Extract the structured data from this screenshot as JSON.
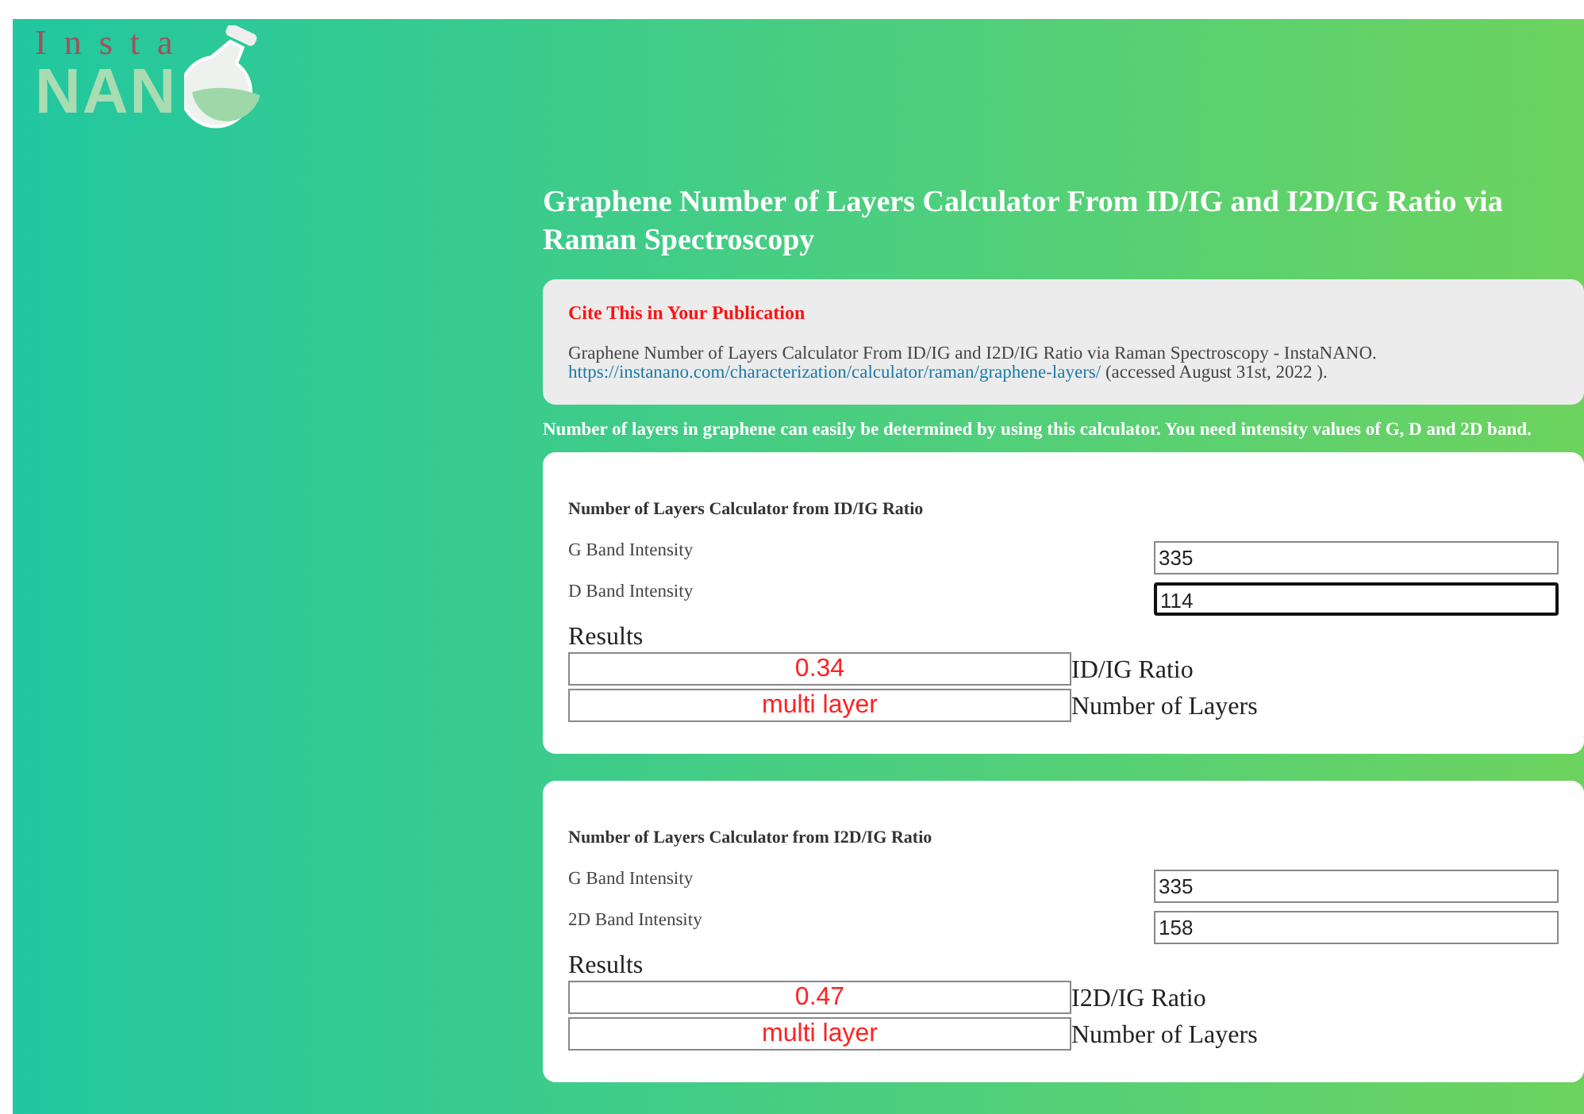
{
  "logo": {
    "top": "Insta",
    "bottom": "NAN"
  },
  "title": "Graphene Number of Layers Calculator From ID/IG and I2D/IG Ratio via Raman Spectroscopy",
  "citation": {
    "heading": "Cite This in Your Publication",
    "text": "Graphene Number of Layers Calculator From ID/IG and I2D/IG Ratio via Raman Spectroscopy - InstaNANO.",
    "link": "https://instanano.com/characterization/calculator/raman/graphene-layers/",
    "accessed": "(accessed August 31st, 2022 )."
  },
  "intro": "Number of layers in graphene can easily be determined by using this calculator. You need intensity values of G, D and 2D band.",
  "calculators": [
    {
      "heading": "Number of Layers Calculator from ID/IG Ratio",
      "fields": [
        {
          "label": "G Band Intensity",
          "value": "335",
          "focused": false
        },
        {
          "label": "D Band Intensity",
          "value": "114",
          "focused": true
        }
      ],
      "results_label": "Results",
      "results": [
        {
          "value": "0.34",
          "label": "ID/IG Ratio"
        },
        {
          "value": "multi layer",
          "label": "Number of Layers"
        }
      ]
    },
    {
      "heading": "Number of Layers Calculator from I2D/IG Ratio",
      "fields": [
        {
          "label": "G Band Intensity",
          "value": "335",
          "focused": false
        },
        {
          "label": "2D Band Intensity",
          "value": "158",
          "focused": false
        }
      ],
      "results_label": "Results",
      "results": [
        {
          "value": "0.47",
          "label": "I2D/IG Ratio"
        },
        {
          "value": "multi layer",
          "label": "Number of Layers"
        }
      ]
    }
  ]
}
